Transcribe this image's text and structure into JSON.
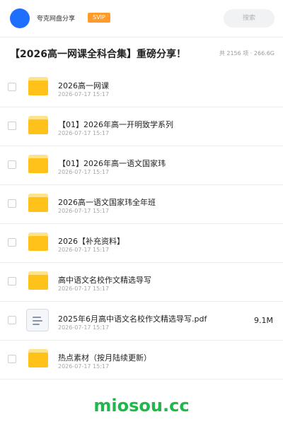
{
  "header": {
    "site_name": "夸克网盘分享",
    "badge": "SVIP",
    "search_placeholder": "搜索"
  },
  "share": {
    "title": "【2026高一网课全科合集】重磅分享！",
    "stats": "共 2156 项 · 266.6G"
  },
  "items": [
    {
      "name": "2026高一网课",
      "date": "2026-07-17 15:17",
      "type": "folder",
      "size": ""
    },
    {
      "name": "【01】2026年高一开明致学系列",
      "date": "2026-07-17 15:17",
      "type": "folder",
      "size": ""
    },
    {
      "name": "【01】2026年高一语文国家玮",
      "date": "2026-07-17 15:17",
      "type": "folder",
      "size": ""
    },
    {
      "name": "2026高一语文国家玮全年班",
      "date": "2026-07-17 15:17",
      "type": "folder",
      "size": ""
    },
    {
      "name": "2026【补充资料】",
      "date": "2026-07-17 15:17",
      "type": "folder",
      "size": ""
    },
    {
      "name": "高中语文名校作文精选导写",
      "date": "2026-07-17 15:17",
      "type": "folder",
      "size": ""
    },
    {
      "name": "2025年6月高中语文名校作文精选导写.pdf",
      "date": "2026-07-17 15:17",
      "type": "file",
      "size": "9.1M"
    },
    {
      "name": "热点素材（按月陆续更新）",
      "date": "2026-07-17 15:17",
      "type": "folder",
      "size": ""
    }
  ],
  "watermark": "miosou.cc",
  "colors": {
    "accent": "#1f6fff",
    "badge": "#ff9a2b",
    "folder": "#ffc21a",
    "watermark": "#1fb84a"
  }
}
